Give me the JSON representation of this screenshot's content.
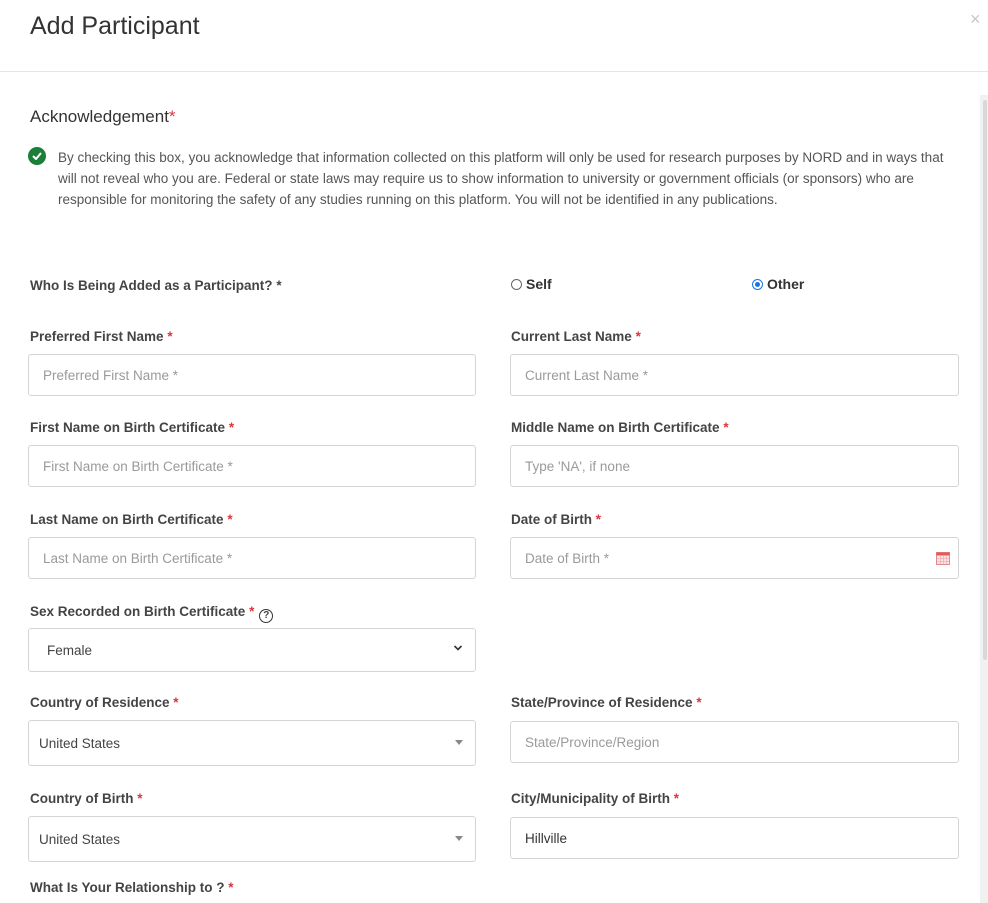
{
  "modal": {
    "title": "Add Participant",
    "close_label": "×"
  },
  "acknowledgement": {
    "title": "Acknowledgement",
    "required_mark": "*",
    "checked": true,
    "text": "By checking this box, you acknowledge that information collected on this platform will only be used for research purposes by NORD and in ways that will not reveal who you are. Federal or state laws may require us to show information to university or government officials (or sponsors) who are responsible for monitoring the safety of any studies running on this platform. You will not be identified in any publications."
  },
  "participant_type": {
    "label": "Who Is Being Added as a Participant?",
    "required_mark": "*",
    "options": [
      {
        "label": "Self",
        "checked": false
      },
      {
        "label": "Other",
        "checked": true
      }
    ]
  },
  "fields": {
    "preferred_first_name": {
      "label": "Preferred First Name",
      "required_mark": "*",
      "value": "",
      "placeholder": "Preferred First Name *"
    },
    "current_last_name": {
      "label": "Current Last Name",
      "required_mark": "*",
      "value": "",
      "placeholder": "Current Last Name *"
    },
    "first_name_birth": {
      "label": "First Name on Birth Certificate",
      "required_mark": "*",
      "value": "",
      "placeholder": "First Name on Birth Certificate *"
    },
    "middle_name_birth": {
      "label": "Middle Name on Birth Certificate",
      "required_mark": "*",
      "value": "",
      "placeholder": "Type 'NA', if none"
    },
    "last_name_birth": {
      "label": "Last Name on Birth Certificate",
      "required_mark": "*",
      "value": "",
      "placeholder": "Last Name on Birth Certificate *"
    },
    "date_of_birth": {
      "label": "Date of Birth",
      "required_mark": "*",
      "value": "",
      "placeholder": "Date of Birth *"
    },
    "sex_birth": {
      "label": "Sex Recorded on Birth Certificate",
      "required_mark": "*",
      "help": "?",
      "value": "Female"
    },
    "country_residence": {
      "label": "Country of Residence",
      "required_mark": "*",
      "value": "United States"
    },
    "state_residence": {
      "label": "State/Province of Residence",
      "required_mark": "*",
      "value": "",
      "placeholder": "State/Province/Region"
    },
    "country_birth": {
      "label": "Country of Birth",
      "required_mark": "*",
      "value": "United States"
    },
    "city_birth": {
      "label": "City/Municipality of Birth",
      "required_mark": "*",
      "value": "Hillville",
      "placeholder": ""
    },
    "relationship": {
      "label": "What Is Your Relationship to ?",
      "required_mark": "*"
    }
  },
  "colors": {
    "required": "#d9363e",
    "check_green": "#1a7f37",
    "radio_blue": "#1a73e8"
  }
}
